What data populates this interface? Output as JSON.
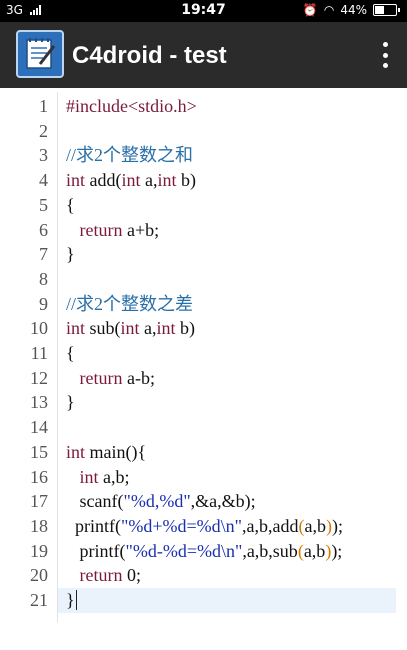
{
  "status_bar": {
    "network": "3G",
    "time": "19:47",
    "battery": "44%",
    "battery_level": 0.44
  },
  "app_bar": {
    "title": "C4droid - test",
    "icon": "notepad-pen-icon",
    "menu_icon": "overflow-menu-icon"
  },
  "colors": {
    "keyword": "#7a1a3a",
    "preprocessor": "#7a1a3a",
    "comment": "#2a6fa8",
    "string": "#1a2fb0",
    "number": "#111111",
    "paren": "#d47a00",
    "text": "#111111"
  },
  "editor": {
    "current_line": 21,
    "lines": [
      {
        "n": "1",
        "tokens": [
          {
            "t": "#include<stdio.h>",
            "c": "preprocessor"
          }
        ]
      },
      {
        "n": "2",
        "tokens": []
      },
      {
        "n": "3",
        "tokens": [
          {
            "t": "//求2个整数之和",
            "c": "comment"
          }
        ]
      },
      {
        "n": "4",
        "tokens": [
          {
            "t": "int",
            "c": "keyword"
          },
          {
            "t": " add(",
            "c": "text"
          },
          {
            "t": "int",
            "c": "keyword"
          },
          {
            "t": " a,",
            "c": "text"
          },
          {
            "t": "int",
            "c": "keyword"
          },
          {
            "t": " b)",
            "c": "text"
          }
        ]
      },
      {
        "n": "5",
        "tokens": [
          {
            "t": "{",
            "c": "text"
          }
        ]
      },
      {
        "n": "6",
        "tokens": [
          {
            "t": "   ",
            "c": "text"
          },
          {
            "t": "return",
            "c": "keyword"
          },
          {
            "t": " a+b;",
            "c": "text"
          }
        ]
      },
      {
        "n": "7",
        "tokens": [
          {
            "t": "}",
            "c": "text"
          }
        ]
      },
      {
        "n": "8",
        "tokens": []
      },
      {
        "n": "9",
        "tokens": [
          {
            "t": "//求2个整数之差",
            "c": "comment"
          }
        ]
      },
      {
        "n": "10",
        "tokens": [
          {
            "t": "int",
            "c": "keyword"
          },
          {
            "t": " sub(",
            "c": "text"
          },
          {
            "t": "int",
            "c": "keyword"
          },
          {
            "t": " a,",
            "c": "text"
          },
          {
            "t": "int",
            "c": "keyword"
          },
          {
            "t": " b)",
            "c": "text"
          }
        ]
      },
      {
        "n": "11",
        "tokens": [
          {
            "t": "{",
            "c": "text"
          }
        ]
      },
      {
        "n": "12",
        "tokens": [
          {
            "t": "   ",
            "c": "text"
          },
          {
            "t": "return",
            "c": "keyword"
          },
          {
            "t": " a-b;",
            "c": "text"
          }
        ]
      },
      {
        "n": "13",
        "tokens": [
          {
            "t": "}",
            "c": "text"
          }
        ]
      },
      {
        "n": "14",
        "tokens": []
      },
      {
        "n": "15",
        "tokens": [
          {
            "t": "int",
            "c": "keyword"
          },
          {
            "t": " main(){",
            "c": "text"
          }
        ]
      },
      {
        "n": "16",
        "tokens": [
          {
            "t": "   ",
            "c": "text"
          },
          {
            "t": "int",
            "c": "keyword"
          },
          {
            "t": " a,b;",
            "c": "text"
          }
        ]
      },
      {
        "n": "17",
        "tokens": [
          {
            "t": "   scanf(",
            "c": "text"
          },
          {
            "t": "\"%d,%d\"",
            "c": "string"
          },
          {
            "t": ",&a,&b);",
            "c": "text"
          }
        ]
      },
      {
        "n": "18",
        "tokens": [
          {
            "t": "  printf(",
            "c": "text"
          },
          {
            "t": "\"%d+%d=%d\\n\"",
            "c": "string"
          },
          {
            "t": ",a,b,add",
            "c": "text"
          },
          {
            "t": "(",
            "c": "paren"
          },
          {
            "t": "a,b",
            "c": "text"
          },
          {
            "t": ")",
            "c": "paren"
          },
          {
            "t": ");",
            "c": "text"
          }
        ]
      },
      {
        "n": "19",
        "tokens": [
          {
            "t": "   printf(",
            "c": "text"
          },
          {
            "t": "\"%d-%d=%d\\n\"",
            "c": "string"
          },
          {
            "t": ",a,b,sub",
            "c": "text"
          },
          {
            "t": "(",
            "c": "paren"
          },
          {
            "t": "a,b",
            "c": "text"
          },
          {
            "t": ")",
            "c": "paren"
          },
          {
            "t": ");",
            "c": "text"
          }
        ]
      },
      {
        "n": "20",
        "tokens": [
          {
            "t": "   ",
            "c": "text"
          },
          {
            "t": "return",
            "c": "keyword"
          },
          {
            "t": " 0;",
            "c": "text"
          }
        ]
      },
      {
        "n": "21",
        "tokens": [
          {
            "t": "}",
            "c": "text"
          }
        ]
      }
    ]
  }
}
